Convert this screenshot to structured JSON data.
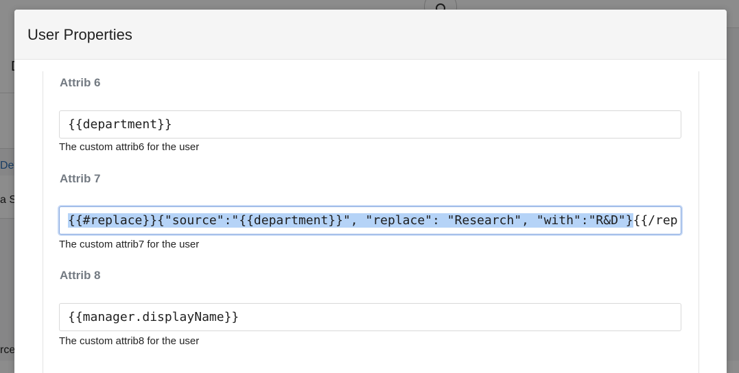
{
  "modal": {
    "title": "User Properties"
  },
  "fields": [
    {
      "label": "Attrib 6",
      "value": "{{department}}",
      "help": "The custom attrib6 for the user"
    },
    {
      "label": "Attrib 7",
      "value_selected": "{{#replace}}{\"source\":\"{{department}}\", \"replace\": \"Research\", \"with\":\"R&D\"}",
      "value_unselected": "{{/rep",
      "help": "The custom attrib7 for the user"
    },
    {
      "label": "Attrib 8",
      "value": "{{manager.displayName}}",
      "help": "The custom attrib8 for the user"
    }
  ],
  "background": {
    "frag_d": "D",
    "frag_det": "Det",
    "frag_as": "a S",
    "frag_rce": "rce"
  },
  "colors": {
    "selection": "#b5d3f7",
    "focus_border": "#86a8df",
    "label": "#737a82"
  }
}
